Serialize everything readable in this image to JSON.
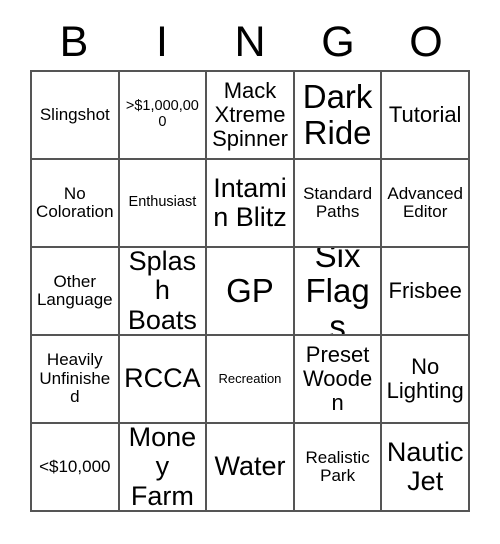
{
  "card": {
    "title": "BINGO",
    "header_letters": [
      "B",
      "I",
      "N",
      "G",
      "O"
    ],
    "grid_size": "5x5",
    "colors": {
      "text": "#000000",
      "grid_line": "#555555",
      "cell_background": "#ffffff",
      "page_background": "#ffffff"
    },
    "rows": [
      [
        {
          "text": "Slingshot",
          "size": "sm"
        },
        {
          "text": ">$1,000,000",
          "size": "xs"
        },
        {
          "text": "Mack Xtreme Spinner",
          "size": "md"
        },
        {
          "text": "Dark Ride",
          "size": "xl"
        },
        {
          "text": "Tutorial",
          "size": "md"
        }
      ],
      [
        {
          "text": "No Coloration",
          "size": "sm"
        },
        {
          "text": "Enthusiast",
          "size": "xs"
        },
        {
          "text": "Intamin Blitz",
          "size": "lg"
        },
        {
          "text": "Standard Paths",
          "size": "sm"
        },
        {
          "text": "Advanced Editor",
          "size": "sm"
        }
      ],
      [
        {
          "text": "Other Language",
          "size": "sm"
        },
        {
          "text": "Splash Boats",
          "size": "lg"
        },
        {
          "text": "GP",
          "size": "xl"
        },
        {
          "text": "Six Flags",
          "size": "xl"
        },
        {
          "text": "Frisbee",
          "size": "md"
        }
      ],
      [
        {
          "text": "Heavily Unfinished",
          "size": "sm"
        },
        {
          "text": "RCCA",
          "size": "lg"
        },
        {
          "text": "Recreation",
          "size": "xxs"
        },
        {
          "text": "Preset Wooden",
          "size": "md"
        },
        {
          "text": "No Lighting",
          "size": "md"
        }
      ],
      [
        {
          "text": "<$10,000",
          "size": "sm"
        },
        {
          "text": "Money Farm",
          "size": "lg"
        },
        {
          "text": "Water",
          "size": "lg"
        },
        {
          "text": "Realistic Park",
          "size": "sm"
        },
        {
          "text": "Nautic Jet",
          "size": "lg"
        }
      ]
    ]
  }
}
